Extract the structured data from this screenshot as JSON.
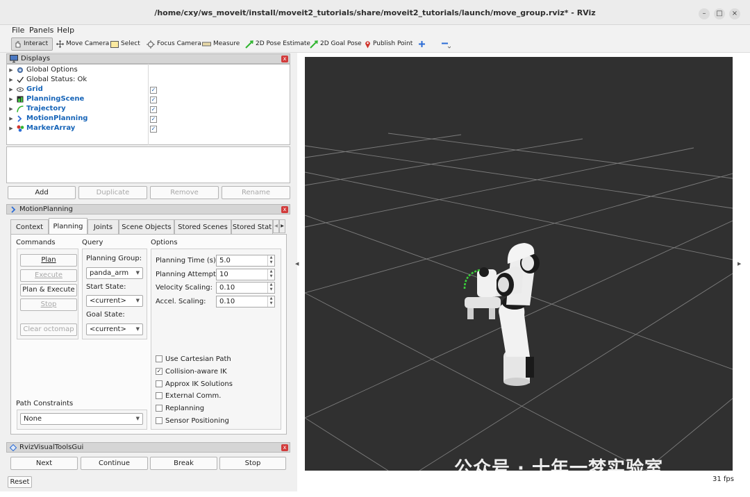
{
  "window": {
    "title": "/home/cxy/ws_moveit/install/moveit2_tutorials/share/moveit2_tutorials/launch/move_group.rviz* - RViz",
    "controls": [
      "–",
      "□",
      "×"
    ]
  },
  "menu": [
    "File",
    "Panels",
    "Help"
  ],
  "toolbar": {
    "interact": "Interact",
    "move_camera": "Move Camera",
    "select": "Select",
    "focus_camera": "Focus Camera",
    "measure": "Measure",
    "pose_estimate": "2D Pose Estimate",
    "goal_pose": "2D Goal Pose",
    "publish_point": "Publish Point"
  },
  "displays": {
    "title": "Displays",
    "items": [
      {
        "label": "Global Options",
        "icon": "gear-icon",
        "checked": null
      },
      {
        "label": "Global Status: Ok",
        "icon": "check-icon",
        "checked": null
      },
      {
        "label": "Grid",
        "icon": "grid-icon",
        "checked": true
      },
      {
        "label": "PlanningScene",
        "icon": "planning-scene-icon",
        "checked": true
      },
      {
        "label": "Trajectory",
        "icon": "trajectory-icon",
        "checked": true
      },
      {
        "label": "MotionPlanning",
        "icon": "motion-planning-icon",
        "checked": true
      },
      {
        "label": "MarkerArray",
        "icon": "marker-array-icon",
        "checked": true
      }
    ],
    "buttons": {
      "add": "Add",
      "duplicate": "Duplicate",
      "remove": "Remove",
      "rename": "Rename"
    }
  },
  "motion_planning": {
    "title": "MotionPlanning",
    "tabs": [
      "Context",
      "Planning",
      "Joints",
      "Scene Objects",
      "Stored Scenes",
      "Stored Stat"
    ],
    "active_tab": "Planning",
    "commands": {
      "label": "Commands",
      "plan": "Plan",
      "execute": "Execute",
      "plan_execute": "Plan & Execute",
      "stop": "Stop",
      "clear_octomap": "Clear octomap"
    },
    "query": {
      "label": "Query",
      "planning_group_label": "Planning Group:",
      "planning_group": "panda_arm",
      "start_state_label": "Start State:",
      "start_state": "<current>",
      "goal_state_label": "Goal State:",
      "goal_state": "<current>"
    },
    "options": {
      "label": "Options",
      "planning_time_label": "Planning Time (s):",
      "planning_time": "5.0",
      "planning_attempts_label": "Planning Attempts:",
      "planning_attempts": "10",
      "velocity_scaling_label": "Velocity Scaling:",
      "velocity_scaling": "0.10",
      "accel_scaling_label": "Accel. Scaling:",
      "accel_scaling": "0.10",
      "checkboxes": [
        {
          "label": "Use Cartesian Path",
          "checked": false
        },
        {
          "label": "Collision-aware IK",
          "checked": true
        },
        {
          "label": "Approx IK Solutions",
          "checked": false
        },
        {
          "label": "External Comm.",
          "checked": false
        },
        {
          "label": "Replanning",
          "checked": false
        },
        {
          "label": "Sensor Positioning",
          "checked": false
        }
      ]
    },
    "path_constraints": {
      "label": "Path Constraints",
      "value": "None"
    }
  },
  "visual_tools": {
    "title": "RvizVisualToolsGui",
    "next": "Next",
    "continue": "Continue",
    "break": "Break",
    "stop": "Stop"
  },
  "footer": {
    "reset": "Reset",
    "fps": "31 fps"
  },
  "watermark": "公众号 · 十年一梦实验室"
}
